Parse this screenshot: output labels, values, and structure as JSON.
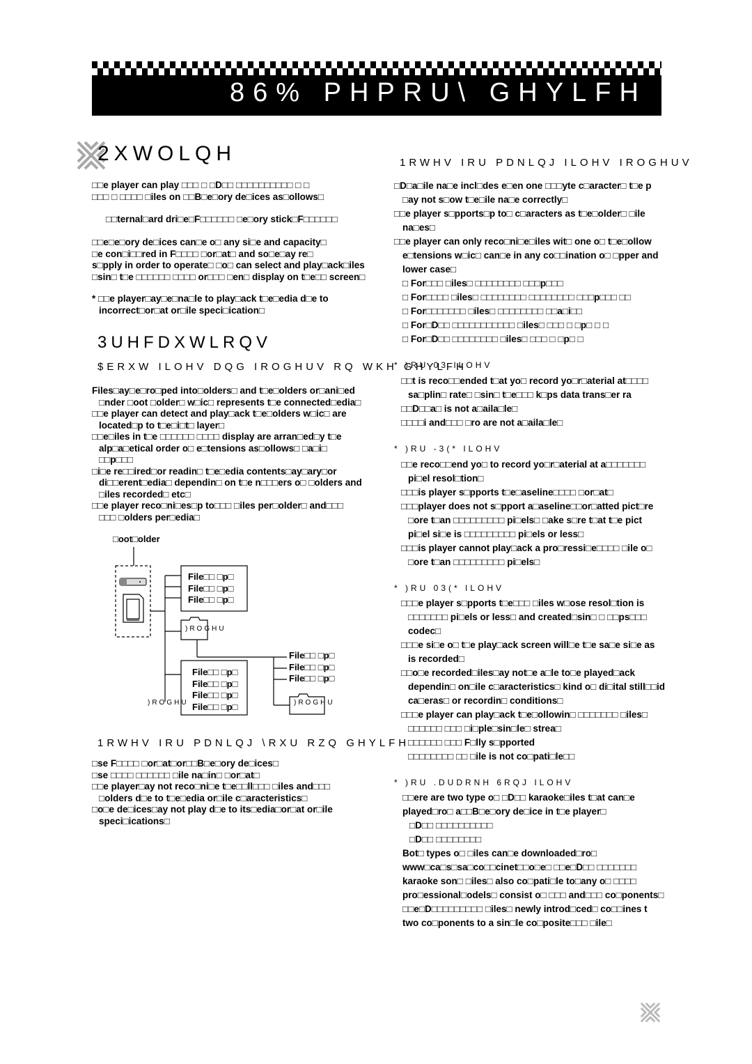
{
  "banner": {
    "title": "86% PHPRU\\ GHYLFH"
  },
  "outline": {
    "heading": "2XWOLQH",
    "paragraphs": [
      [
        "□□e player can play □□□ □ □D□□ □□□□□□□□□□ □ □",
        "□□□ □ □□□□ □iles on □□B□e□ory de□ices as□ollows□"
      ],
      [
        "□□ternal□ard dri□e□F□□□□□□ □e□ory stick□F□□□□□□"
      ],
      [
        "□□e□e□ory de□ices can□e o□ any si□e and capacity□",
        "□e con□i□□red in F□□□□ □or□at□ and so□e□ay re□",
        "s□pply in order to operate□ □o□ can select and play□ack□iles",
        "□sin□ t□e □□□□□□ □□□□ or□□□ □en□ display on t□e□□ screen□"
      ],
      [
        "* □□e player□ay□e□na□le to play□ack t□e□edia d□e to",
        "incorrect□or□at or□ile speci□ication□"
      ]
    ]
  },
  "precautions": {
    "heading": "3UHFDXWLRQV",
    "about_heading": "$ERXW ILOHV DQG IROGHUV RQ WKH GHYLFH",
    "about_items": [
      [
        "Files□ay□e□ro□ped into□olders□ and t□e□olders or□ani□ed",
        "□nder □oot □older□ w□ic□ represents t□e connected□edia□"
      ],
      [
        "□□e player can detect and play□ack t□e□olders w□ic□ are",
        "located□p to t□e□i□t□ layer□"
      ],
      [
        "□□e□iles in t□e □□□□□□ □□□□ display are arran□ed□y t□e",
        "alp□a□etical order o□ e□tensions as□ollows□ □a□i□",
        "□□p□□□"
      ],
      [
        "□i□e re□□ired□or readin□ t□e□edia contents□ay□ary□or",
        "di□□erent□edia□ dependin□ on t□e n□□□ers o□ □olders and",
        "□iles recorded□ etc□"
      ],
      [
        "□□e player reco□ni□es□p to□□□ □iles per□older□ and□□□",
        "□□□ □olders per□edia□"
      ]
    ],
    "tree": {
      "root_label": "□oot□older",
      "file_label": "File□□ □p□",
      "folder_label": ")ROGHU"
    },
    "own_device_heading": "1RWHV IRU PDNLQJ \\RXU RZQ GHYLFH",
    "own_device_items": [
      [
        "□se F□□□□ □or□at□or□□B□e□ory de□ices□"
      ],
      [
        "□se □□□□ □□□□□□ □ile na□in□ □or□at□"
      ],
      [
        "□□e player□ay not reco□ni□e t□e□□ll□□□ □iles and□□□",
        "□olders d□e to t□e□edia or□ile c□aracteristics□"
      ],
      [
        "□o□e de□ices□ay not play d□e to its□edia□or□at or□ile",
        "speci□ications□"
      ]
    ]
  },
  "making_files": {
    "heading": "1RWHV IRU PDNLQJ ILOHV IROGHUV",
    "items": [
      [
        "□D□a□ile na□e incl□des e□en one □□□yte c□aracter□ t□e p",
        "□ay not s□ow t□e□ile na□e correctly□"
      ],
      [
        "□□e player s□pports□p to□ c□aracters as t□e□older□ □ile",
        "na□es□"
      ],
      [
        "□□e player can only reco□ni□e□iles wit□ one o□ t□e□ollow",
        "e□tensions w□ic□ can□e in any co□□ination o□ □pper and",
        "lower case□"
      ]
    ],
    "formats": [
      "□ For□□□ □iles□ □□□□□□□□ □□□p□□□",
      "□ For□□□□ □iles□ □□□□□□□□ □□□□□□□□ □□□p□□□ □□",
      "□ For□□□□□□□ □iles□ □□□□□□□□ □□a□i□□",
      "□ For□D□□ □□□□□□□□□□□ □iles□ □□□ □ □p□ □ □",
      "□ For□D□□ □□□□□□□□ □iles□ □□□ □ □p□ □"
    ],
    "mp3": {
      "heading": "* )RU 03 ILOHV",
      "items": [
        [
          "□□t is reco□□ended t□at yo□ record yo□r□aterial at□□□□",
          "sa□plin□ rate□ □sin□ t□e□□□ k□ps data trans□er ra"
        ],
        [
          "□□D□□a□ is not a□aila□le□"
        ],
        [
          "□□□□i and□□□ □ro are not a□aila□le□"
        ]
      ]
    },
    "jpeg": {
      "heading": "* )RU -3(* ILOHV",
      "items": [
        [
          "□□e reco□□end yo□ to record yo□r□aterial at a□□□□□□□",
          "pi□el resol□tion□"
        ],
        [
          "□□□is player s□pports t□e□aseline□□□□ □or□at□"
        ],
        [
          "□□□player does not s□pport a□aseline□□or□atted pict□re",
          "□ore t□an □□□□□□□□□ pi□els□ □ake s□re t□at t□e pict",
          "pi□el si□e is □□□□□□□□□ pi□els or less□"
        ],
        [
          "□□□is player cannot play□ack a pro□ressi□e□□□□ □ile o□",
          "□ore t□an □□□□□□□□□ pi□els□"
        ]
      ]
    },
    "mpeg4": {
      "heading": "* )RU 03(*  ILOHV",
      "items": [
        [
          "□□□e player s□pports t□e□□□ □iles w□ose resol□tion is",
          "□□□□□□□ pi□els or less□ and created□sin□ □ □□ps□□□",
          "codec□"
        ],
        [
          "□□□e si□e o□ t□e play□ack screen will□e t□e sa□e si□e as",
          "is recorded□"
        ],
        [
          "□□o□e recorded□iles□ay not□e a□le to□e played□ack",
          "dependin□ on□ile c□aracteristics□ kind o□ di□ital still□□id",
          "ca□eras□ or recordin□ conditions□"
        ],
        [
          "□□□e player can play□ack t□e□ollowin□ □□□□□□□ □iles□",
          "□□□□□□ □□□ □i□ple□sin□le□ strea□",
          "□□□□□□ □□□ F□lly s□pported",
          "□□□□□□□□ □□ □ile is not co□pati□le□□"
        ]
      ]
    },
    "karaoke": {
      "heading": "* )RU .DUDRNH 6RQJ ILOHV",
      "lines": [
        "□□ere are two type o□ □D□□ karaoke□iles t□at can□e",
        "played□ro□ a□□B□e□ory de□ice in t□e player□",
        "□D□□ □□□□□□□□□□",
        "□D□□ □□□□□□□□",
        "Bot□ types o□ □iles can□e downloaded□ro□",
        "www□ca□s□sa□co□□cinet□□o□e□ □□e□D□□ □□□□□□□",
        "karaoke son□ □iles□ also co□pati□le to□any o□ □□□□",
        "pro□essional□odels□ consist o□ □□□ and□□□ co□ponents□",
        "□□e□D□□□□□□□□□ □iles□ newly introd□ced□ co□□ines t",
        "two co□ponents to a sin□le co□posite□□□ □ile□"
      ]
    }
  },
  "colors": {
    "banner_bg": "#000000",
    "banner_text": "#ffffff",
    "logo_gray": "#a8a8a8"
  }
}
